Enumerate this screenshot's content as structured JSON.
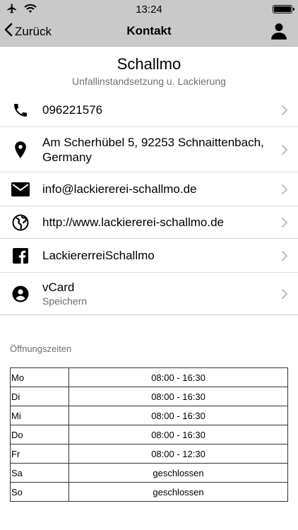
{
  "status": {
    "time": "13:24"
  },
  "nav": {
    "back_label": "Zurück",
    "title": "Kontakt"
  },
  "company": {
    "name": "Schallmo",
    "subtitle": "Unfallinstandsetzung u. Lackierung"
  },
  "contacts": [
    {
      "icon": "phone-icon",
      "text": "096221576"
    },
    {
      "icon": "location-pin-icon",
      "text": "Am Scherhübel 5, 92253 Schnaittenbach, Germany"
    },
    {
      "icon": "mail-icon",
      "text": "info@lackiererei-schallmo.de"
    },
    {
      "icon": "globe-icon",
      "text": "http://www.lackiererei-schallmo.de"
    },
    {
      "icon": "facebook-icon",
      "text": "LackiererreiSchallmo"
    },
    {
      "icon": "user-circle-icon",
      "text": "vCard",
      "subtext": "Speichern"
    }
  ],
  "hours": {
    "label": "Öffnungszeiten",
    "rows": [
      {
        "day": "Mo",
        "time": "08:00 - 16:30"
      },
      {
        "day": "Di",
        "time": "08:00 - 16:30"
      },
      {
        "day": "Mi",
        "time": "08:00 - 16:30"
      },
      {
        "day": "Do",
        "time": "08:00 - 16:30"
      },
      {
        "day": "Fr",
        "time": "08:00 - 12:30"
      },
      {
        "day": "Sa",
        "time": "geschlossen"
      },
      {
        "day": "So",
        "time": "geschlossen"
      }
    ]
  }
}
